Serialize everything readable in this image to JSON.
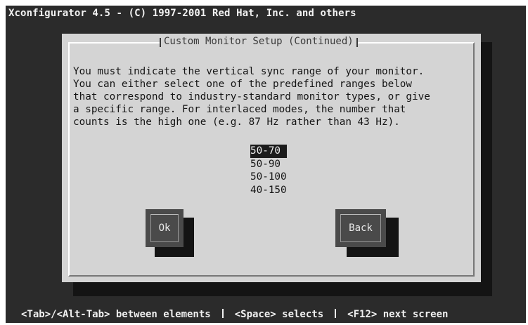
{
  "app": {
    "title": "Xconfigurator 4.5 - (C) 1997-2001 Red Hat, Inc. and others"
  },
  "dialog": {
    "title": "Custom Monitor Setup (Continued)",
    "message_lines": [
      "You must indicate the vertical sync range of your monitor.",
      "You can either select one of the predefined ranges below",
      "that correspond to industry-standard monitor types, or give",
      "a specific range. For interlaced modes, the number that",
      "counts is the high one (e.g. 87 Hz rather than 43 Hz)."
    ],
    "ranges": [
      "50-70",
      "50-90",
      "50-100",
      "40-150"
    ],
    "selected_range": "50-70",
    "ok_label": "Ok",
    "back_label": "Back"
  },
  "help": {
    "tab": "<Tab>/<Alt-Tab> between elements",
    "space": "<Space> selects",
    "f12": "<F12> next screen"
  },
  "colors": {
    "screen_background": "#2b2b2b",
    "dialog_background": "#d4d4d4",
    "selection_background": "#1b1b1b",
    "button_background": "#4a4a4a"
  }
}
